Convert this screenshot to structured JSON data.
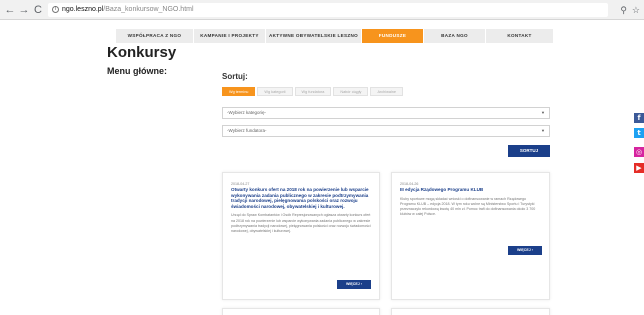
{
  "browser": {
    "url_host": "ngo.leszno.pl",
    "url_path": "/Baza_konkursow_NGO.html"
  },
  "topnav": {
    "items": [
      {
        "label": "WSPÓŁPRACA Z NGO"
      },
      {
        "label": "KAMPANIE I PROJEKTY"
      },
      {
        "label": "AKTYWNE OBYWATELSKIE LESZNO"
      },
      {
        "label": "FUNDUSZE",
        "active": true
      },
      {
        "label": "BAZA NGO"
      },
      {
        "label": "KONTAKT"
      }
    ],
    "active_color": "#f7941d"
  },
  "page": {
    "title": "Konkursy",
    "menu_title": "Menu główne:"
  },
  "sort": {
    "label": "Sortuj:",
    "tabs": [
      {
        "label": "Wg terminu",
        "active": true
      },
      {
        "label": "Wg kategorii"
      },
      {
        "label": "Wg fundatora"
      },
      {
        "label": "Nabór ciągły"
      },
      {
        "label": "Archiwalne"
      }
    ],
    "category_placeholder": "-Wybierz kategorię-",
    "funder_placeholder": "-Wybierz fundatora-",
    "button_label": "SORTUJ"
  },
  "cards": [
    {
      "date": "2018-04-27",
      "title": "Otwarty konkurs ofert na 2018 rok na powierzenie lub wsparcie wykonywania zadania publicznego w zakresie podtrzymywania tradycji narodowej, pielęgnowania polskości oraz rozwoju świadomości narodowej, obywatelskiej i kulturowej.",
      "text": "Urząd do Spraw Kombatantów i Osób Represjonowanych ogłasza otwarty konkurs ofert na 2018 rok na powierzenie lub wsparcie wykonywania zadania publicznego w zakresie podtrzymywania tradycji narodowej, pielęgnowania polskości oraz rozwoju świadomości narodowej, obywatelskiej i kulturowej.",
      "button": "WIĘCEJ"
    },
    {
      "date": "2018-04-26",
      "title": "III edycja Rządowego Programu KLUB",
      "text": "Kluby sportowe mogą składać wnioski o dofinansowanie w ramach Rządowego Programu KLUB – edycja 2018. W tym roku wolne są Ministerstwo Sportu i Turystyki przeznaczyło rekordową kwotę 40 mln zł. Pomoc trafi do dofinansowania około 3 700 klubów w całej Polsce.",
      "button": "WIĘCEJ"
    }
  ],
  "social": {
    "facebook_icon": "f",
    "twitter_icon": "t",
    "instagram_icon": "◎",
    "youtube_icon": "▶"
  },
  "colors": {
    "brand_blue": "#1b3f8a",
    "accent_orange": "#f7941d"
  }
}
